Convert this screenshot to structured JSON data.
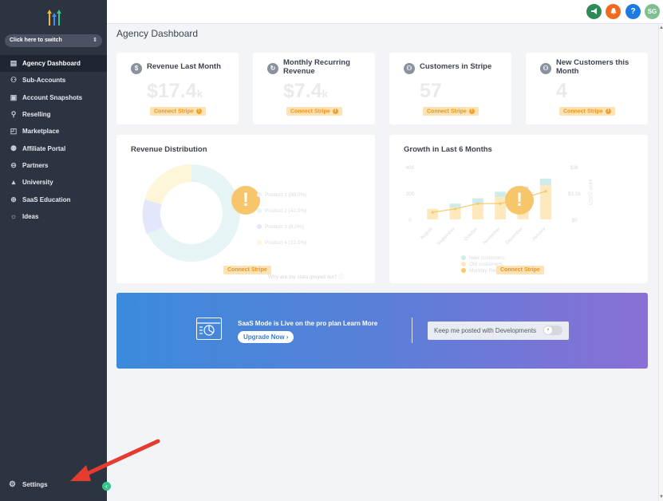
{
  "sidebar": {
    "switcher_label": "Click here to switch",
    "items": [
      {
        "label": "Agency Dashboard",
        "icon": "dashboard-icon"
      },
      {
        "label": "Sub-Accounts",
        "icon": "user-icon"
      },
      {
        "label": "Account Snapshots",
        "icon": "snapshot-icon"
      },
      {
        "label": "Reselling",
        "icon": "reselling-icon"
      },
      {
        "label": "Marketplace",
        "icon": "bag-icon"
      },
      {
        "label": "Affiliate Portal",
        "icon": "group-icon"
      },
      {
        "label": "Partners",
        "icon": "handshake-icon"
      },
      {
        "label": "University",
        "icon": "graduation-cap-icon"
      },
      {
        "label": "SaaS Education",
        "icon": "globe-icon"
      },
      {
        "label": "Ideas",
        "icon": "lightbulb-icon"
      }
    ],
    "settings_label": "Settings"
  },
  "topbar": {
    "avatar_initials": "SG",
    "help_label": "?",
    "colors": {
      "megaphone": "#2e8b57",
      "bell": "#f26b1d",
      "help": "#1f7ae0",
      "avatar": "#7fbf8f"
    }
  },
  "page": {
    "title": "Agency Dashboard"
  },
  "stats": [
    {
      "title": "Revenue Last Month",
      "value": "$17.4",
      "suffix": "k",
      "cta": "Connect Stripe",
      "icon": "dollar-icon"
    },
    {
      "title": "Monthly Recurring Revenue",
      "value": "$7.4",
      "suffix": "k",
      "cta": "Connect Stripe",
      "icon": "refresh-icon"
    },
    {
      "title": "Customers in Stripe",
      "value": "57",
      "suffix": "",
      "cta": "Connect Stripe",
      "icon": "lock-user-icon"
    },
    {
      "title": "New Customers this Month",
      "value": "4",
      "suffix": "",
      "cta": "Connect Stripe",
      "icon": "lock-user-icon"
    }
  ],
  "revenue_distribution": {
    "title": "Revenue Distribution",
    "cta": "Connect Stripe",
    "footer_text": "Why are my stats greyed out?",
    "legend": [
      {
        "label": "Product 1 (38.0%)",
        "color": "#e6f4f6"
      },
      {
        "label": "Product 2 (41.0%)",
        "color": "#e6f4f6"
      },
      {
        "label": "Product 3 (9.0%)",
        "color": "#e4e6fb"
      },
      {
        "label": "Product 4 (22.0%)",
        "color": "#fff6da"
      }
    ]
  },
  "growth": {
    "title": "Growth in Last 6 Months",
    "cta": "Connect Stripe",
    "y_left_ticks": [
      "400",
      "200",
      "0"
    ],
    "y_right_ticks": [
      "$3k",
      "$1.5k",
      "$0"
    ],
    "y_right_label": "MRR (USD)",
    "months": [
      "August",
      "September",
      "October",
      "November",
      "December",
      "January"
    ],
    "legend": [
      {
        "label": "New customers",
        "color": "#cfecec"
      },
      {
        "label": "Old customers",
        "color": "#fde9bd"
      },
      {
        "label": "Monthly Recurring",
        "color": "#f6c866"
      }
    ]
  },
  "chart_data": {
    "type": "bar",
    "categories": [
      "August",
      "September",
      "October",
      "November",
      "December",
      "January"
    ],
    "series": [
      {
        "name": "Old customers",
        "values": [
          80,
          90,
          120,
          170,
          210,
          260
        ]
      },
      {
        "name": "New customers",
        "values": [
          0,
          30,
          40,
          40,
          40,
          50
        ]
      },
      {
        "name": "Monthly Recurring",
        "values": [
          0.4,
          0.6,
          0.9,
          0.9,
          1.2,
          1.6
        ]
      }
    ],
    "title": "Growth in Last 6 Months",
    "ylim": [
      0,
      400
    ],
    "ylim_right": [
      0,
      3
    ]
  },
  "banner": {
    "headline": "SaaS Mode is Live on the pro plan",
    "learn_more": "Learn More",
    "upgrade_label": "Upgrade Now",
    "keep_posted_label": "Keep me posted with Developments"
  }
}
